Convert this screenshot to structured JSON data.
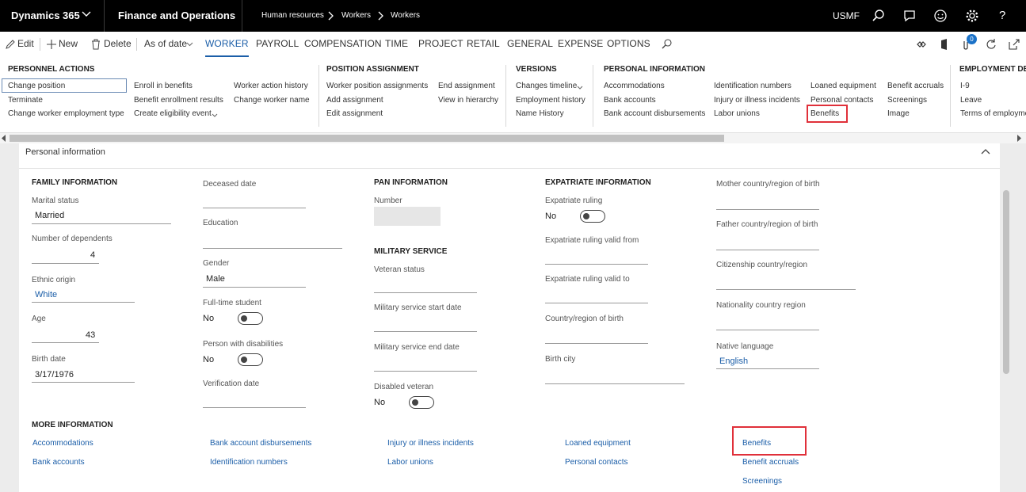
{
  "topbar": {
    "app_name": "Dynamics 365",
    "module": "Finance and Operations",
    "breadcrumb": [
      "Human resources",
      "Workers",
      "Workers"
    ],
    "company": "USMF",
    "notification_count": "0"
  },
  "actionbar": {
    "edit": "Edit",
    "new": "New",
    "delete": "Delete",
    "as_of_date": "As of date",
    "tabs": [
      "WORKER",
      "PAYROLL",
      "COMPENSATION",
      "TIME",
      "PROJECT",
      "RETAIL",
      "GENERAL",
      "EXPENSE",
      "OPTIONS"
    ]
  },
  "ribbon": {
    "personnel_actions": {
      "title": "PERSONNEL ACTIONS",
      "col1": [
        "Change position",
        "Terminate",
        "Change worker employment type"
      ],
      "col2": [
        "Enroll in benefits",
        "Benefit enrollment results",
        "Create eligibility event"
      ],
      "col3": [
        "Worker action history",
        "Change worker name"
      ]
    },
    "position_assignment": {
      "title": "POSITION ASSIGNMENT",
      "col1": [
        "Worker position assignments",
        "Add assignment",
        "Edit assignment"
      ],
      "col2": [
        "End assignment",
        "View in hierarchy"
      ]
    },
    "versions": {
      "title": "VERSIONS",
      "items": [
        "Changes timeline",
        "Employment history",
        "Name History"
      ]
    },
    "personal_information": {
      "title": "PERSONAL INFORMATION",
      "col1": [
        "Accommodations",
        "Bank accounts",
        "Bank account disbursements"
      ],
      "col2": [
        "Identification numbers",
        "Injury or illness incidents",
        "Labor unions"
      ],
      "col3": [
        "Loaned equipment",
        "Personal contacts",
        "Benefits"
      ],
      "col4": [
        "Benefit accruals",
        "Screenings",
        "Image"
      ]
    },
    "employment_details": {
      "title": "EMPLOYMENT DETA",
      "items": [
        "I-9",
        "Leave",
        "Terms of employme"
      ]
    }
  },
  "panel": {
    "title": "Personal information",
    "family": {
      "title": "FAMILY INFORMATION",
      "marital_status_label": "Marital status",
      "marital_status": "Married",
      "dependents_label": "Number of dependents",
      "dependents": "4",
      "ethnic_origin_label": "Ethnic origin",
      "ethnic_origin": "White",
      "age_label": "Age",
      "age": "43",
      "birth_date_label": "Birth date",
      "birth_date": "3/17/1976"
    },
    "col2": {
      "deceased_label": "Deceased date",
      "education_label": "Education",
      "gender_label": "Gender",
      "gender": "Male",
      "fulltime_label": "Full-time student",
      "fulltime": "No",
      "disabilities_label": "Person with disabilities",
      "disabilities": "No",
      "verification_label": "Verification date"
    },
    "pan": {
      "title": "PAN INFORMATION",
      "number_label": "Number"
    },
    "military": {
      "title": "MILITARY SERVICE",
      "veteran_label": "Veteran status",
      "start_label": "Military service start date",
      "end_label": "Military service end date",
      "disabled_label": "Disabled veteran",
      "disabled": "No"
    },
    "expat": {
      "title": "EXPATRIATE INFORMATION",
      "ruling_label": "Expatriate ruling",
      "ruling": "No",
      "valid_from_label": "Expatriate ruling valid from",
      "valid_to_label": "Expatriate ruling valid to",
      "birth_country_label": "Country/region of birth",
      "birth_city_label": "Birth city"
    },
    "col5": {
      "mother_label": "Mother country/region of birth",
      "father_label": "Father country/region of birth",
      "citizenship_label": "Citizenship country/region",
      "nationality_label": "Nationality country region",
      "language_label": "Native language",
      "language": "English"
    },
    "more": {
      "title": "MORE INFORMATION",
      "col1": [
        "Accommodations",
        "Bank accounts"
      ],
      "col2": [
        "Bank account disbursements",
        "Identification numbers"
      ],
      "col3": [
        "Injury or illness incidents",
        "Labor unions"
      ],
      "col4": [
        "Loaned equipment",
        "Personal contacts"
      ],
      "col5": [
        "Benefits",
        "Benefit accruals",
        "Screenings"
      ]
    }
  },
  "colors": {
    "link": "#1b5ea8",
    "highlight": "#e0303a",
    "topbar": "#000000"
  }
}
